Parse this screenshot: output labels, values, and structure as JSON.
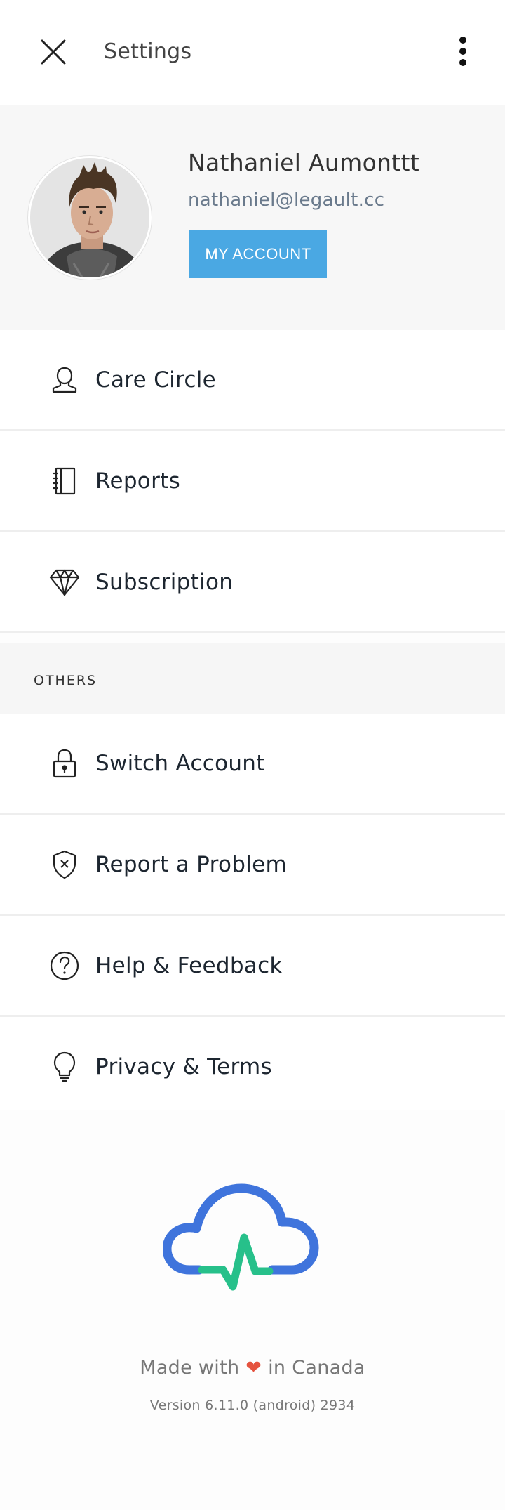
{
  "header": {
    "title": "Settings",
    "close_icon": "close-icon",
    "more_icon": "more-vertical-icon"
  },
  "profile": {
    "name": "Nathaniel Aumonttt",
    "email": "nathaniel@legault.cc",
    "account_button_label": "MY ACCOUNT",
    "accent_color": "#4aa8e3"
  },
  "menu": {
    "items": [
      {
        "label": "Care Circle",
        "icon": "user-icon"
      },
      {
        "label": "Reports",
        "icon": "notebook-icon"
      },
      {
        "label": "Subscription",
        "icon": "diamond-icon"
      }
    ]
  },
  "others": {
    "section_label": "OTHERS",
    "items": [
      {
        "label": "Switch Account",
        "icon": "lock-icon"
      },
      {
        "label": "Report a Problem",
        "icon": "shield-x-icon"
      },
      {
        "label": "Help & Feedback",
        "icon": "help-circle-icon"
      },
      {
        "label": "Privacy & Terms",
        "icon": "lightbulb-icon"
      }
    ]
  },
  "footer": {
    "made_prefix": "Made with",
    "made_suffix": "in Canada",
    "version": "Version 6.11.0 (android) 2934",
    "logo_icon": "cloud-heartbeat-logo",
    "logo_colors": {
      "cloud": "#3f74dc",
      "pulse": "#27c08a"
    }
  }
}
